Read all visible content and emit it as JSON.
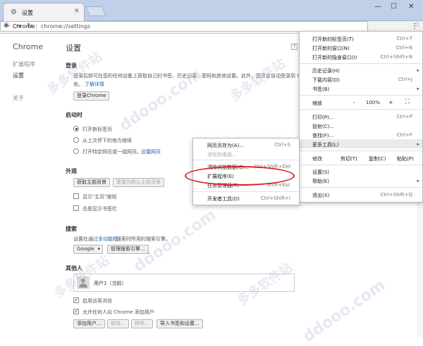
{
  "tab": {
    "title": "设置",
    "icon": "gear-icon"
  },
  "omnibox": {
    "chip": "Chrome",
    "url": "chrome://settings"
  },
  "sidebar": {
    "title": "Chrome",
    "items": [
      "扩展程序",
      "设置",
      "关于"
    ]
  },
  "main": {
    "title": "设置",
    "login": {
      "heading": "登录",
      "text1": "登录后即可在您的任何设备上获取自己的书签、历史记录、密码和其他设置。此外，您还会自动登录到 Go",
      "text2": "务。",
      "link": "了解详情",
      "button": "登录Chrome"
    },
    "startup": {
      "heading": "启动时",
      "options": [
        "打开新标签页",
        "从上次停下的地方继续",
        "打开特定网页或一组网页。"
      ],
      "link": "设置网页"
    },
    "appearance": {
      "heading": "外观",
      "btn_theme": "获取主题背景",
      "btn_reset": "重置为默认主题背景",
      "check_home": "显示\"主页\"按钮",
      "check_bookmarks": "总是显示书签栏"
    },
    "search": {
      "heading": "搜索",
      "text_pre": "设置在通过",
      "link": "多功能框",
      "text_post": "搜索时所用的搜索引擎。",
      "engine": "Google",
      "manage": "管理搜索引擎..."
    },
    "people": {
      "heading": "其他人",
      "user": "用户1（当前）",
      "check_guest": "启用访客浏览",
      "check_add": "允许任何人向 Chrome 添加用户",
      "buttons": [
        "添加用户...",
        "修改...",
        "移除...",
        "导入书签和设置..."
      ]
    }
  },
  "menu": {
    "items": [
      {
        "label": "打开新的标签页(T)",
        "shortcut": "Ctrl+T"
      },
      {
        "label": "打开新的窗口(N)",
        "shortcut": "Ctrl+N"
      },
      {
        "label": "打开新的隐身窗口(I)",
        "shortcut": "Ctrl+Shift+N"
      },
      {
        "label": "历史记录(H)",
        "shortcut": ""
      },
      {
        "label": "下载内容(D)",
        "shortcut": "Ctrl+J"
      },
      {
        "label": "书签(B)",
        "shortcut": ""
      },
      {
        "label": "打印(P)...",
        "shortcut": "Ctrl+P"
      },
      {
        "label": "投射(C)...",
        "shortcut": ""
      },
      {
        "label": "查找(F)...",
        "shortcut": "Ctrl+F"
      },
      {
        "label": "更多工具(L)",
        "shortcut": ""
      },
      {
        "label": "设置(S)",
        "shortcut": ""
      },
      {
        "label": "帮助(E)",
        "shortcut": ""
      },
      {
        "label": "退出(X)",
        "shortcut": "Ctrl+Shift+Q"
      }
    ],
    "zoom": {
      "label": "缩放",
      "minus": "-",
      "value": "100%",
      "plus": "+"
    },
    "edit": {
      "label": "修改",
      "cut": "剪切(T)",
      "copy": "复制(C)",
      "paste": "粘贴(P)"
    }
  },
  "submenu": {
    "items": [
      {
        "label": "网页另存为(A)...",
        "shortcut": "Ctrl+S"
      },
      {
        "label": "添加到桌面...",
        "shortcut": ""
      },
      {
        "label": "清除浏览数据(C)...",
        "shortcut": "Ctrl+Shift+Del"
      },
      {
        "label": "扩展程序(E)",
        "shortcut": ""
      },
      {
        "label": "任务管理器(T)",
        "shortcut": "Shift+Esc"
      },
      {
        "label": "开发者工具(D)",
        "shortcut": "Ctrl+Shift+I"
      }
    ]
  },
  "watermark": {
    "brand": "多多软件站",
    "domain": "ddooo.com"
  }
}
